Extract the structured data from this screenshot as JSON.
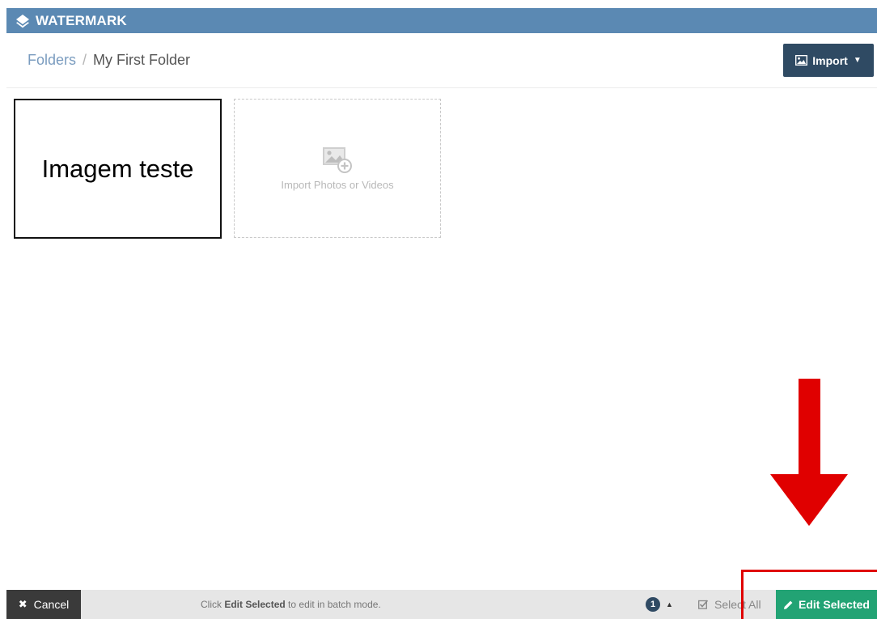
{
  "app": {
    "brand": "WATERMARK",
    "logo_icon": "layers-diamond-icon",
    "topbar_color": "#5b89b3"
  },
  "breadcrumb": {
    "root": "Folders",
    "separator": "/",
    "current": "My First Folder"
  },
  "header": {
    "import_label": "Import",
    "import_icon": "image-icon",
    "import_caret_icon": "caret-down-icon"
  },
  "gallery": {
    "image_tile_text": "Imagem teste",
    "import_tile_text": "Import Photos or Videos",
    "import_tile_icon": "add-image-icon"
  },
  "annotation": {
    "arrow_icon": "down-arrow-icon",
    "color": "#e00000"
  },
  "footer": {
    "cancel_label": "Cancel",
    "cancel_icon": "close-icon",
    "hint_prefix": "Click",
    "hint_bold": "Edit Selected",
    "hint_suffix": "to edit in batch mode.",
    "selected_count": "1",
    "expand_icon": "caret-up-icon",
    "select_all_label": "Select All",
    "select_all_icon": "checkbox-icon",
    "edit_selected_label": "Edit Selected",
    "edit_icon": "pencil-icon",
    "edit_color": "#22a374"
  }
}
